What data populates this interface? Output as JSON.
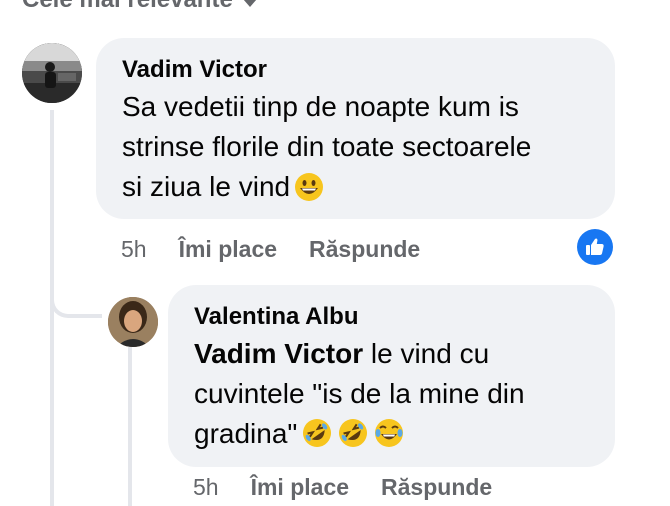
{
  "sort": {
    "label": "Cele mai relevante"
  },
  "comments": [
    {
      "author": "Vadim Victor",
      "text_lines": [
        "Sa vedetii tinp de noapte kum is",
        "strinse florile din toate sectoarele",
        "si ziua le vind"
      ],
      "emoji": "grinning-face",
      "time": "5h",
      "like_label": "Îmi place",
      "reply_label": "Răspunde",
      "reaction": "like"
    },
    {
      "author": "Valentina Albu",
      "mention": "Vadim Victor",
      "text_lines": [
        " le vind cu",
        "cuvintele \"is de la mine din",
        "gradina\""
      ],
      "emojis": [
        "rolling-on-floor-laughing",
        "rolling-on-floor-laughing",
        "face-with-tears-of-joy"
      ],
      "time": "5h",
      "like_label": "Îmi place",
      "reply_label": "Răspunde"
    }
  ],
  "colors": {
    "bubble": "#f0f2f5",
    "secondary_text": "#65676b",
    "like_blue": "#1877f2"
  }
}
